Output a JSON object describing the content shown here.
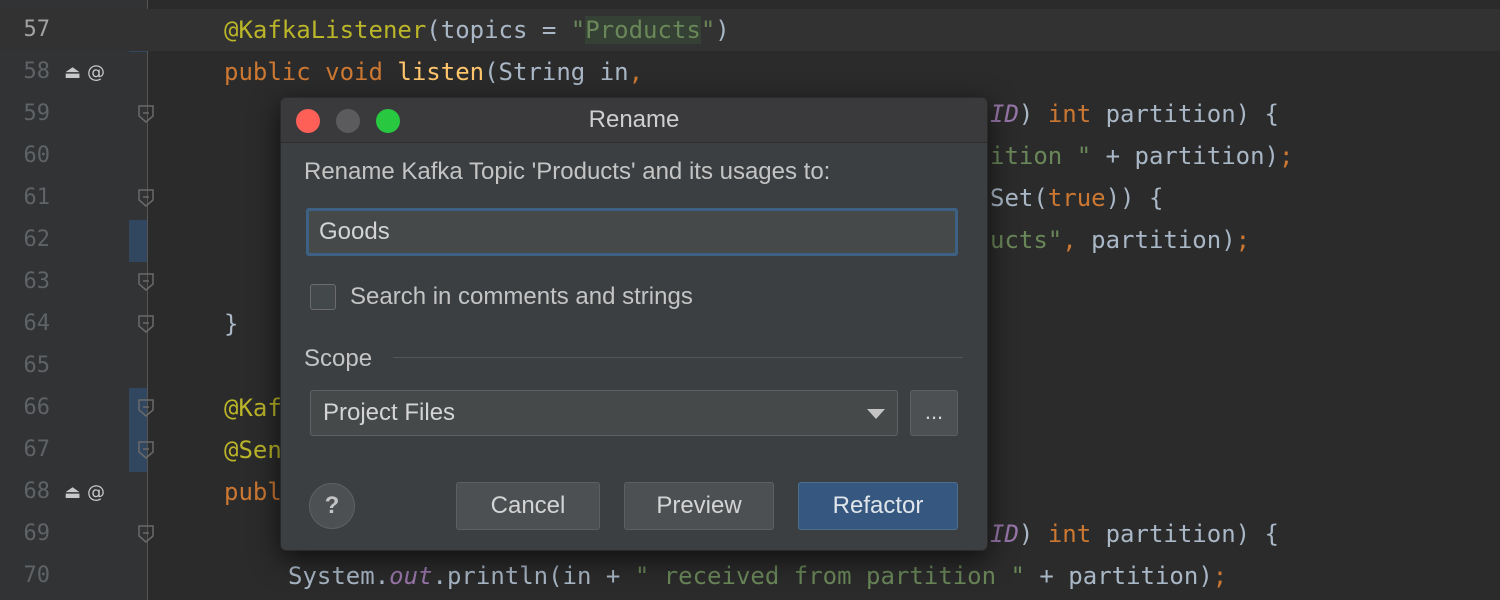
{
  "editor": {
    "lines": [
      {
        "num": "57",
        "current": true,
        "segments": [
          {
            "t": "@KafkaListener",
            "c": "ann"
          },
          {
            "t": "(topics = ",
            "c": ""
          },
          {
            "t": "\"",
            "c": "str"
          },
          {
            "t": "Products",
            "c": "str-hl"
          },
          {
            "t": "\"",
            "c": "str"
          },
          {
            "t": ")",
            "c": ""
          }
        ]
      },
      {
        "num": "58",
        "icons": true,
        "segments": [
          {
            "t": "public ",
            "c": "kw"
          },
          {
            "t": "void ",
            "c": "kw"
          },
          {
            "t": "listen",
            "c": "fn"
          },
          {
            "t": "(String in",
            "c": ""
          },
          {
            "t": ",",
            "c": "kw"
          }
        ]
      },
      {
        "num": "59",
        "fold": true,
        "right": [
          {
            "t": "ID",
            "c": "ital"
          },
          {
            "t": ") ",
            "c": ""
          },
          {
            "t": "int ",
            "c": "kw"
          },
          {
            "t": "partition) {",
            "c": ""
          }
        ]
      },
      {
        "num": "60",
        "right": [
          {
            "t": "ition \" ",
            "c": "str"
          },
          {
            "t": "+ partition)",
            "c": ""
          },
          {
            "t": ";",
            "c": "kw"
          }
        ]
      },
      {
        "num": "61",
        "fold": true,
        "right": [
          {
            "t": "Set(",
            "c": ""
          },
          {
            "t": "true",
            "c": "kw"
          },
          {
            "t": ")) {",
            "c": ""
          }
        ]
      },
      {
        "num": "62",
        "right": [
          {
            "t": "ucts\"",
            "c": "str"
          },
          {
            "t": ", ",
            "c": "kw"
          },
          {
            "t": "partition)",
            "c": ""
          },
          {
            "t": ";",
            "c": "kw"
          }
        ]
      },
      {
        "num": "63",
        "fold": true,
        "segments": []
      },
      {
        "num": "64",
        "fold": true,
        "segments": [
          {
            "t": "}",
            "c": ""
          }
        ]
      },
      {
        "num": "65",
        "segments": []
      },
      {
        "num": "66",
        "fold": true,
        "segments": [
          {
            "t": "@Kaf",
            "c": "ann"
          }
        ]
      },
      {
        "num": "67",
        "fold": true,
        "segments": [
          {
            "t": "@Sen",
            "c": "ann"
          }
        ]
      },
      {
        "num": "68",
        "icons": true,
        "segments": [
          {
            "t": "publ",
            "c": "kw"
          }
        ]
      },
      {
        "num": "69",
        "fold": true,
        "right": [
          {
            "t": "ID",
            "c": "ital"
          },
          {
            "t": ") ",
            "c": ""
          },
          {
            "t": "int ",
            "c": "kw"
          },
          {
            "t": "partition) {",
            "c": ""
          }
        ]
      },
      {
        "num": "70",
        "indent": true,
        "segments": [
          {
            "t": "System.",
            "c": ""
          },
          {
            "t": "out",
            "c": "ital"
          },
          {
            "t": ".println(in + ",
            "c": ""
          },
          {
            "t": "\" received from partition \" ",
            "c": "str"
          },
          {
            "t": "+ partition)",
            "c": ""
          },
          {
            "t": ";",
            "c": "kw"
          }
        ]
      }
    ],
    "gutter_icons": {
      "impl": "⏏",
      "at": "@"
    }
  },
  "dialog": {
    "title": "Rename",
    "prompt": "Rename Kafka Topic 'Products' and its usages to:",
    "new_name_value": "Goods",
    "search_checkbox_label": "Search in comments and strings",
    "search_checked": false,
    "scope_label": "Scope",
    "scope_value": "Project Files",
    "more_button": "...",
    "help_label": "?",
    "cancel_label": "Cancel",
    "preview_label": "Preview",
    "refactor_label": "Refactor"
  }
}
